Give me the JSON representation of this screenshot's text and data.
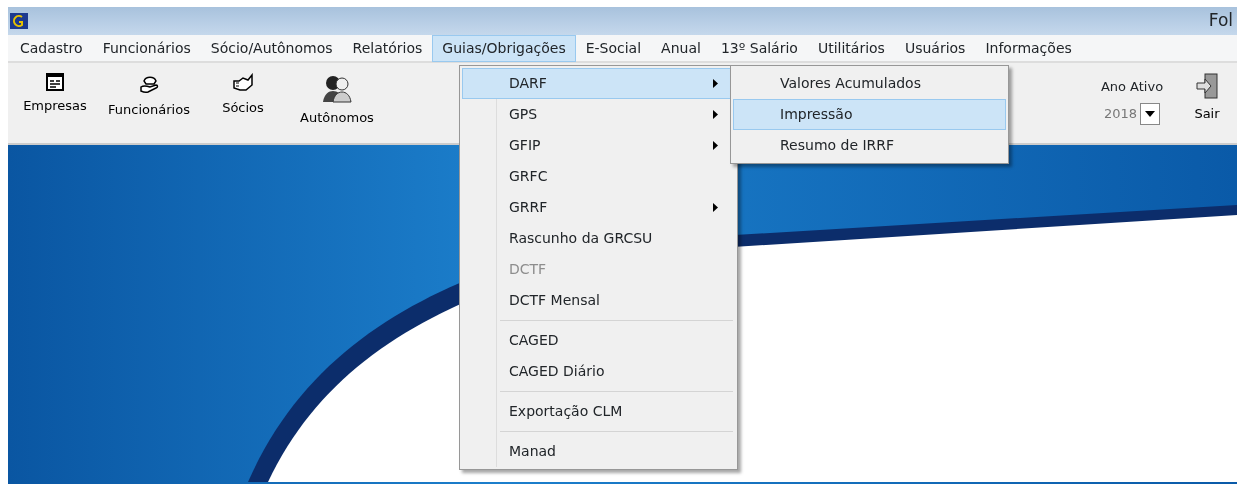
{
  "window": {
    "title": "Fol"
  },
  "menu_bar": [
    {
      "label": "Cadastro",
      "selected": false
    },
    {
      "label": "Funcionários",
      "selected": false
    },
    {
      "label": "Sócio/Autônomos",
      "selected": false
    },
    {
      "label": "Relatórios",
      "selected": false
    },
    {
      "label": "Guias/Obrigações",
      "selected": true
    },
    {
      "label": "E-Social",
      "selected": false
    },
    {
      "label": "Anual",
      "selected": false
    },
    {
      "label": "13º Salário",
      "selected": false
    },
    {
      "label": "Utilitários",
      "selected": false
    },
    {
      "label": "Usuários",
      "selected": false
    },
    {
      "label": "Informações",
      "selected": false
    }
  ],
  "toolbar": [
    {
      "label": "Empresas"
    },
    {
      "label": "Funcionários"
    },
    {
      "label": "Sócios"
    },
    {
      "label": "Autônomos"
    }
  ],
  "ano_ativo": {
    "label": "Ano Ativo",
    "value": "2018"
  },
  "exit_button": {
    "label": "Sair"
  },
  "dropdown": [
    {
      "kind": "item",
      "label": "DARF",
      "submenu": true,
      "disabled": false,
      "selected": true
    },
    {
      "kind": "item",
      "label": "GPS",
      "submenu": true,
      "disabled": false,
      "selected": false
    },
    {
      "kind": "item",
      "label": "GFIP",
      "submenu": true,
      "disabled": false,
      "selected": false
    },
    {
      "kind": "item",
      "label": "GRFC",
      "submenu": false,
      "disabled": false,
      "selected": false
    },
    {
      "kind": "item",
      "label": "GRRF",
      "submenu": true,
      "disabled": false,
      "selected": false
    },
    {
      "kind": "item",
      "label": "Rascunho da GRCSU",
      "submenu": false,
      "disabled": false,
      "selected": false
    },
    {
      "kind": "item",
      "label": "DCTF",
      "submenu": false,
      "disabled": true,
      "selected": false
    },
    {
      "kind": "item",
      "label": "DCTF Mensal",
      "submenu": false,
      "disabled": false,
      "selected": false
    },
    {
      "kind": "separator"
    },
    {
      "kind": "item",
      "label": "CAGED",
      "submenu": false,
      "disabled": false,
      "selected": false
    },
    {
      "kind": "item",
      "label": "CAGED Diário",
      "submenu": false,
      "disabled": false,
      "selected": false
    },
    {
      "kind": "separator"
    },
    {
      "kind": "item",
      "label": "Exportação CLM",
      "submenu": false,
      "disabled": false,
      "selected": false
    },
    {
      "kind": "separator"
    },
    {
      "kind": "item",
      "label": "Manad",
      "submenu": false,
      "disabled": false,
      "selected": false
    }
  ],
  "submenu": [
    {
      "label": "Valores Acumulados",
      "selected": false
    },
    {
      "label": "Impressão",
      "selected": true
    },
    {
      "label": "Resumo de IRRF",
      "selected": false
    }
  ]
}
